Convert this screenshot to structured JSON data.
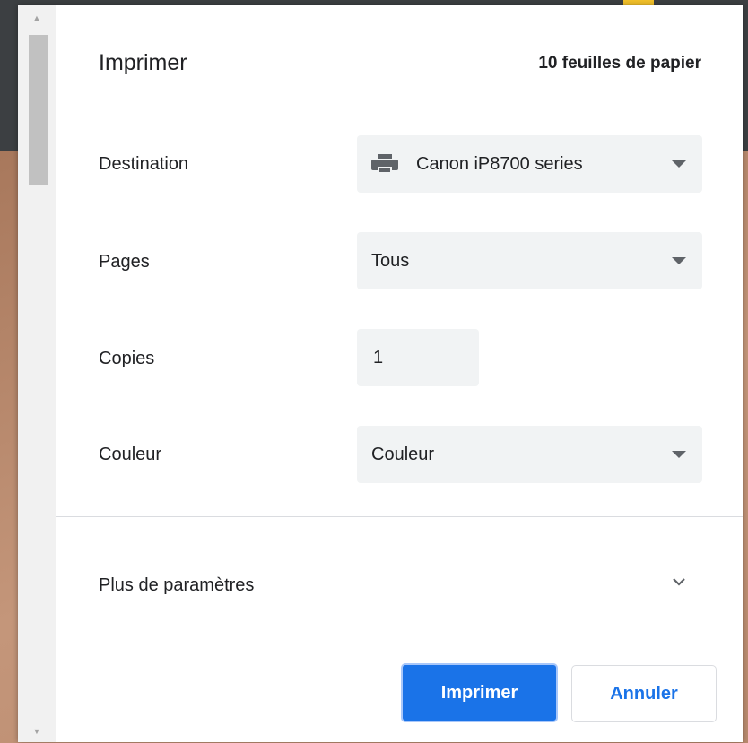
{
  "dialog": {
    "title": "Imprimer",
    "sheet_count": "10 feuilles de papier"
  },
  "destination": {
    "label": "Destination",
    "value": "Canon iP8700 series",
    "icon": "printer-icon"
  },
  "pages": {
    "label": "Pages",
    "value": "Tous"
  },
  "copies": {
    "label": "Copies",
    "value": "1"
  },
  "color": {
    "label": "Couleur",
    "value": "Couleur"
  },
  "more_settings": {
    "label": "Plus de paramètres",
    "icon": "chevron-down-icon"
  },
  "actions": {
    "print_label": "Imprimer",
    "cancel_label": "Annuler"
  },
  "colors": {
    "accent": "#1a73e8",
    "field_bg": "#f1f3f4",
    "text": "#202124"
  }
}
